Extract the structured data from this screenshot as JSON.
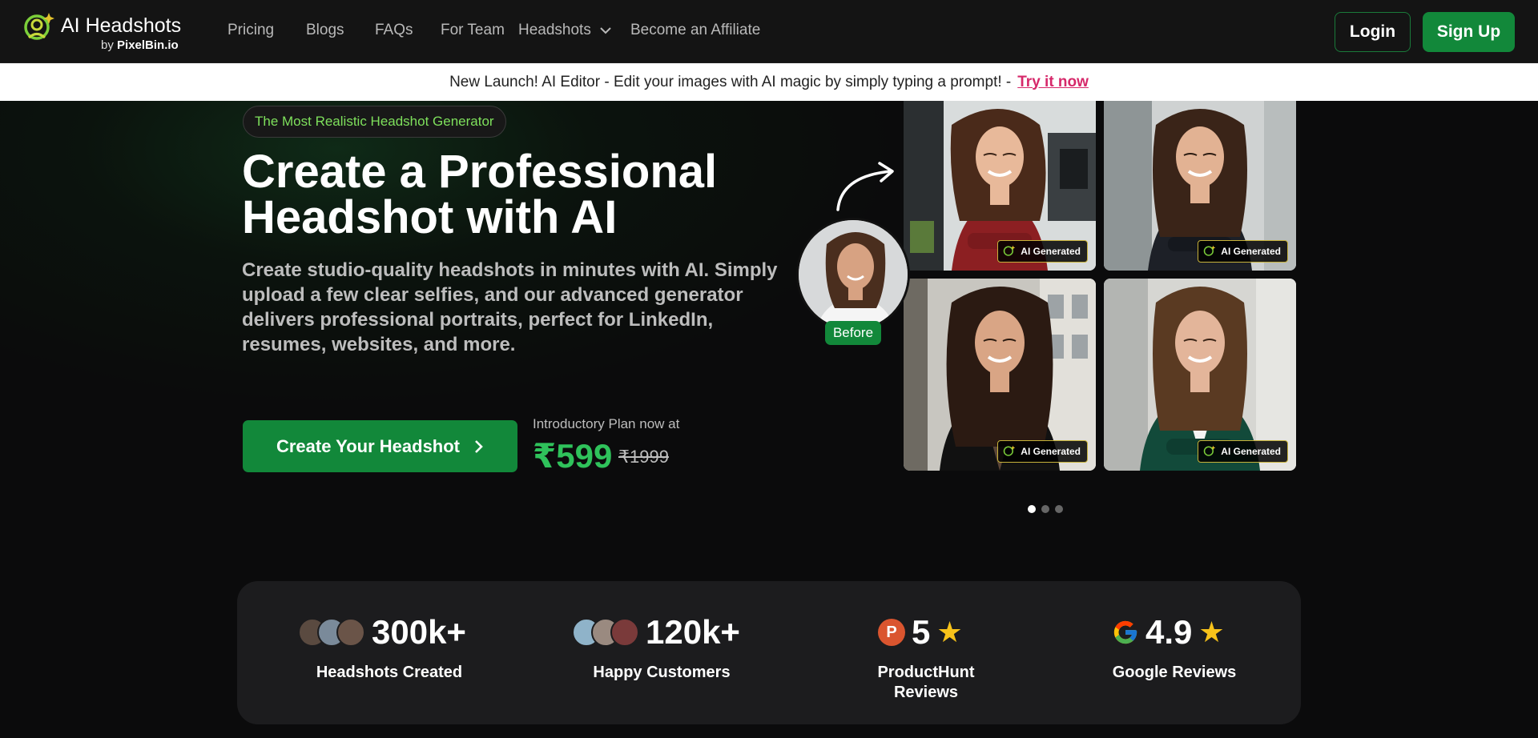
{
  "brand": {
    "title": "AI Headshots",
    "by": "by",
    "company": "PixelBin.io"
  },
  "nav": {
    "links": [
      "Pricing",
      "Blogs",
      "FAQs",
      "For Team",
      "Headshots",
      "Become an Affiliate"
    ],
    "login": "Login",
    "signup": "Sign Up"
  },
  "announcement": {
    "text": "New Launch! AI Editor - Edit your images with AI magic by simply typing a prompt! -",
    "link": "Try it now"
  },
  "hero": {
    "tag": "The Most Realistic Headshot Generator",
    "headline": "Create a Professional Headshot with AI",
    "subcopy": "Create studio-quality headshots in minutes with AI. Simply upload a few clear selfies, and our advanced generator delivers professional portraits, perfect for LinkedIn, resumes, websites, and more.",
    "cta": "Create Your Headshot",
    "intro_label": "Introductory Plan now at",
    "price": "₹599",
    "price_old": "₹1999"
  },
  "gallery": {
    "before_label": "Before",
    "badge": "AI Generated",
    "slide_count": 3,
    "active_slide": 1
  },
  "stats": [
    {
      "value": "300k+",
      "label": "Headshots Created"
    },
    {
      "value": "120k+",
      "label": "Happy Customers"
    },
    {
      "value": "5",
      "label": "ProductHunt Reviews"
    },
    {
      "value": "4.9",
      "label": "Google Reviews"
    }
  ],
  "colors": {
    "accent_green": "#12883a",
    "price_green": "#2fc25b",
    "link_pink": "#d6286a",
    "star": "#f7c21a"
  }
}
